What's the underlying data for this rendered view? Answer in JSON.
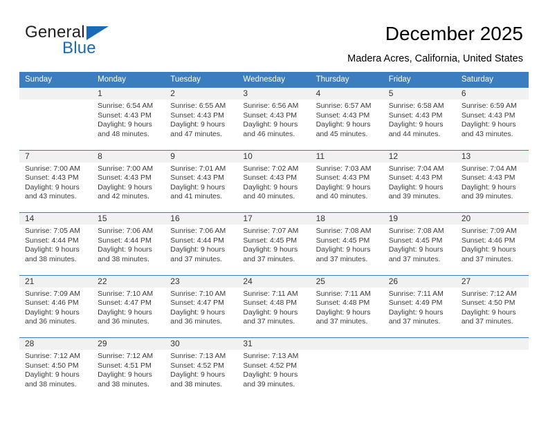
{
  "logo": {
    "word_one": "General",
    "word_two": "Blue",
    "triangle_icon": "triangle-icon",
    "brand_blue": "#1a6ab5",
    "brand_dark": "#231f20"
  },
  "header": {
    "title": "December 2025",
    "subtitle": "Madera Acres, California, United States"
  },
  "calendar": {
    "header_background": "#3b7dbf",
    "daynum_background": "#f1f1f1",
    "weekday_headers": [
      "Sunday",
      "Monday",
      "Tuesday",
      "Wednesday",
      "Thursday",
      "Friday",
      "Saturday"
    ],
    "weeks": [
      [
        {
          "day": "",
          "sunrise": "",
          "sunset": "",
          "daylight": "",
          "daylight2": ""
        },
        {
          "day": "1",
          "sunrise": "Sunrise: 6:54 AM",
          "sunset": "Sunset: 4:43 PM",
          "daylight": "Daylight: 9 hours",
          "daylight2": "and 48 minutes."
        },
        {
          "day": "2",
          "sunrise": "Sunrise: 6:55 AM",
          "sunset": "Sunset: 4:43 PM",
          "daylight": "Daylight: 9 hours",
          "daylight2": "and 47 minutes."
        },
        {
          "day": "3",
          "sunrise": "Sunrise: 6:56 AM",
          "sunset": "Sunset: 4:43 PM",
          "daylight": "Daylight: 9 hours",
          "daylight2": "and 46 minutes."
        },
        {
          "day": "4",
          "sunrise": "Sunrise: 6:57 AM",
          "sunset": "Sunset: 4:43 PM",
          "daylight": "Daylight: 9 hours",
          "daylight2": "and 45 minutes."
        },
        {
          "day": "5",
          "sunrise": "Sunrise: 6:58 AM",
          "sunset": "Sunset: 4:43 PM",
          "daylight": "Daylight: 9 hours",
          "daylight2": "and 44 minutes."
        },
        {
          "day": "6",
          "sunrise": "Sunrise: 6:59 AM",
          "sunset": "Sunset: 4:43 PM",
          "daylight": "Daylight: 9 hours",
          "daylight2": "and 43 minutes."
        }
      ],
      [
        {
          "day": "7",
          "sunrise": "Sunrise: 7:00 AM",
          "sunset": "Sunset: 4:43 PM",
          "daylight": "Daylight: 9 hours",
          "daylight2": "and 43 minutes."
        },
        {
          "day": "8",
          "sunrise": "Sunrise: 7:00 AM",
          "sunset": "Sunset: 4:43 PM",
          "daylight": "Daylight: 9 hours",
          "daylight2": "and 42 minutes."
        },
        {
          "day": "9",
          "sunrise": "Sunrise: 7:01 AM",
          "sunset": "Sunset: 4:43 PM",
          "daylight": "Daylight: 9 hours",
          "daylight2": "and 41 minutes."
        },
        {
          "day": "10",
          "sunrise": "Sunrise: 7:02 AM",
          "sunset": "Sunset: 4:43 PM",
          "daylight": "Daylight: 9 hours",
          "daylight2": "and 40 minutes."
        },
        {
          "day": "11",
          "sunrise": "Sunrise: 7:03 AM",
          "sunset": "Sunset: 4:43 PM",
          "daylight": "Daylight: 9 hours",
          "daylight2": "and 40 minutes."
        },
        {
          "day": "12",
          "sunrise": "Sunrise: 7:04 AM",
          "sunset": "Sunset: 4:43 PM",
          "daylight": "Daylight: 9 hours",
          "daylight2": "and 39 minutes."
        },
        {
          "day": "13",
          "sunrise": "Sunrise: 7:04 AM",
          "sunset": "Sunset: 4:43 PM",
          "daylight": "Daylight: 9 hours",
          "daylight2": "and 39 minutes."
        }
      ],
      [
        {
          "day": "14",
          "sunrise": "Sunrise: 7:05 AM",
          "sunset": "Sunset: 4:44 PM",
          "daylight": "Daylight: 9 hours",
          "daylight2": "and 38 minutes."
        },
        {
          "day": "15",
          "sunrise": "Sunrise: 7:06 AM",
          "sunset": "Sunset: 4:44 PM",
          "daylight": "Daylight: 9 hours",
          "daylight2": "and 38 minutes."
        },
        {
          "day": "16",
          "sunrise": "Sunrise: 7:06 AM",
          "sunset": "Sunset: 4:44 PM",
          "daylight": "Daylight: 9 hours",
          "daylight2": "and 37 minutes."
        },
        {
          "day": "17",
          "sunrise": "Sunrise: 7:07 AM",
          "sunset": "Sunset: 4:45 PM",
          "daylight": "Daylight: 9 hours",
          "daylight2": "and 37 minutes."
        },
        {
          "day": "18",
          "sunrise": "Sunrise: 7:08 AM",
          "sunset": "Sunset: 4:45 PM",
          "daylight": "Daylight: 9 hours",
          "daylight2": "and 37 minutes."
        },
        {
          "day": "19",
          "sunrise": "Sunrise: 7:08 AM",
          "sunset": "Sunset: 4:45 PM",
          "daylight": "Daylight: 9 hours",
          "daylight2": "and 37 minutes."
        },
        {
          "day": "20",
          "sunrise": "Sunrise: 7:09 AM",
          "sunset": "Sunset: 4:46 PM",
          "daylight": "Daylight: 9 hours",
          "daylight2": "and 37 minutes."
        }
      ],
      [
        {
          "day": "21",
          "sunrise": "Sunrise: 7:09 AM",
          "sunset": "Sunset: 4:46 PM",
          "daylight": "Daylight: 9 hours",
          "daylight2": "and 36 minutes."
        },
        {
          "day": "22",
          "sunrise": "Sunrise: 7:10 AM",
          "sunset": "Sunset: 4:47 PM",
          "daylight": "Daylight: 9 hours",
          "daylight2": "and 36 minutes."
        },
        {
          "day": "23",
          "sunrise": "Sunrise: 7:10 AM",
          "sunset": "Sunset: 4:47 PM",
          "daylight": "Daylight: 9 hours",
          "daylight2": "and 36 minutes."
        },
        {
          "day": "24",
          "sunrise": "Sunrise: 7:11 AM",
          "sunset": "Sunset: 4:48 PM",
          "daylight": "Daylight: 9 hours",
          "daylight2": "and 37 minutes."
        },
        {
          "day": "25",
          "sunrise": "Sunrise: 7:11 AM",
          "sunset": "Sunset: 4:48 PM",
          "daylight": "Daylight: 9 hours",
          "daylight2": "and 37 minutes."
        },
        {
          "day": "26",
          "sunrise": "Sunrise: 7:11 AM",
          "sunset": "Sunset: 4:49 PM",
          "daylight": "Daylight: 9 hours",
          "daylight2": "and 37 minutes."
        },
        {
          "day": "27",
          "sunrise": "Sunrise: 7:12 AM",
          "sunset": "Sunset: 4:50 PM",
          "daylight": "Daylight: 9 hours",
          "daylight2": "and 37 minutes."
        }
      ],
      [
        {
          "day": "28",
          "sunrise": "Sunrise: 7:12 AM",
          "sunset": "Sunset: 4:50 PM",
          "daylight": "Daylight: 9 hours",
          "daylight2": "and 38 minutes."
        },
        {
          "day": "29",
          "sunrise": "Sunrise: 7:12 AM",
          "sunset": "Sunset: 4:51 PM",
          "daylight": "Daylight: 9 hours",
          "daylight2": "and 38 minutes."
        },
        {
          "day": "30",
          "sunrise": "Sunrise: 7:13 AM",
          "sunset": "Sunset: 4:52 PM",
          "daylight": "Daylight: 9 hours",
          "daylight2": "and 38 minutes."
        },
        {
          "day": "31",
          "sunrise": "Sunrise: 7:13 AM",
          "sunset": "Sunset: 4:52 PM",
          "daylight": "Daylight: 9 hours",
          "daylight2": "and 39 minutes."
        },
        {
          "day": "",
          "sunrise": "",
          "sunset": "",
          "daylight": "",
          "daylight2": ""
        },
        {
          "day": "",
          "sunrise": "",
          "sunset": "",
          "daylight": "",
          "daylight2": ""
        },
        {
          "day": "",
          "sunrise": "",
          "sunset": "",
          "daylight": "",
          "daylight2": ""
        }
      ]
    ]
  }
}
